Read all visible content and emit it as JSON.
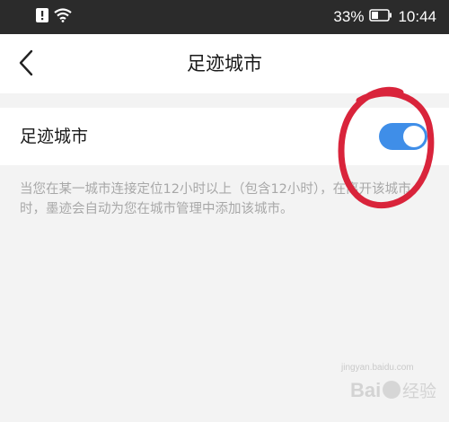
{
  "status_bar": {
    "battery_percent": "33%",
    "time": "10:44",
    "icons": [
      "alert-icon",
      "wifi-icon",
      "battery-icon"
    ]
  },
  "nav": {
    "back_icon": "chevron-left-icon",
    "title": "足迹城市"
  },
  "setting": {
    "label": "足迹城市",
    "toggle_on": true,
    "description": "当您在某一城市连接定位12小时以上（包含12小时），在离开该城市时，墨迹会自动为您在城市管理中添加该城市。"
  },
  "annotation": {
    "circle_color": "#d9243b"
  },
  "watermark": {
    "url": "jingyan.baidu.com",
    "logo_text": "Bai 经验"
  },
  "colors": {
    "accent": "#3f8ee8",
    "background": "#f3f3f3",
    "status_bar": "#2b2b2b"
  }
}
